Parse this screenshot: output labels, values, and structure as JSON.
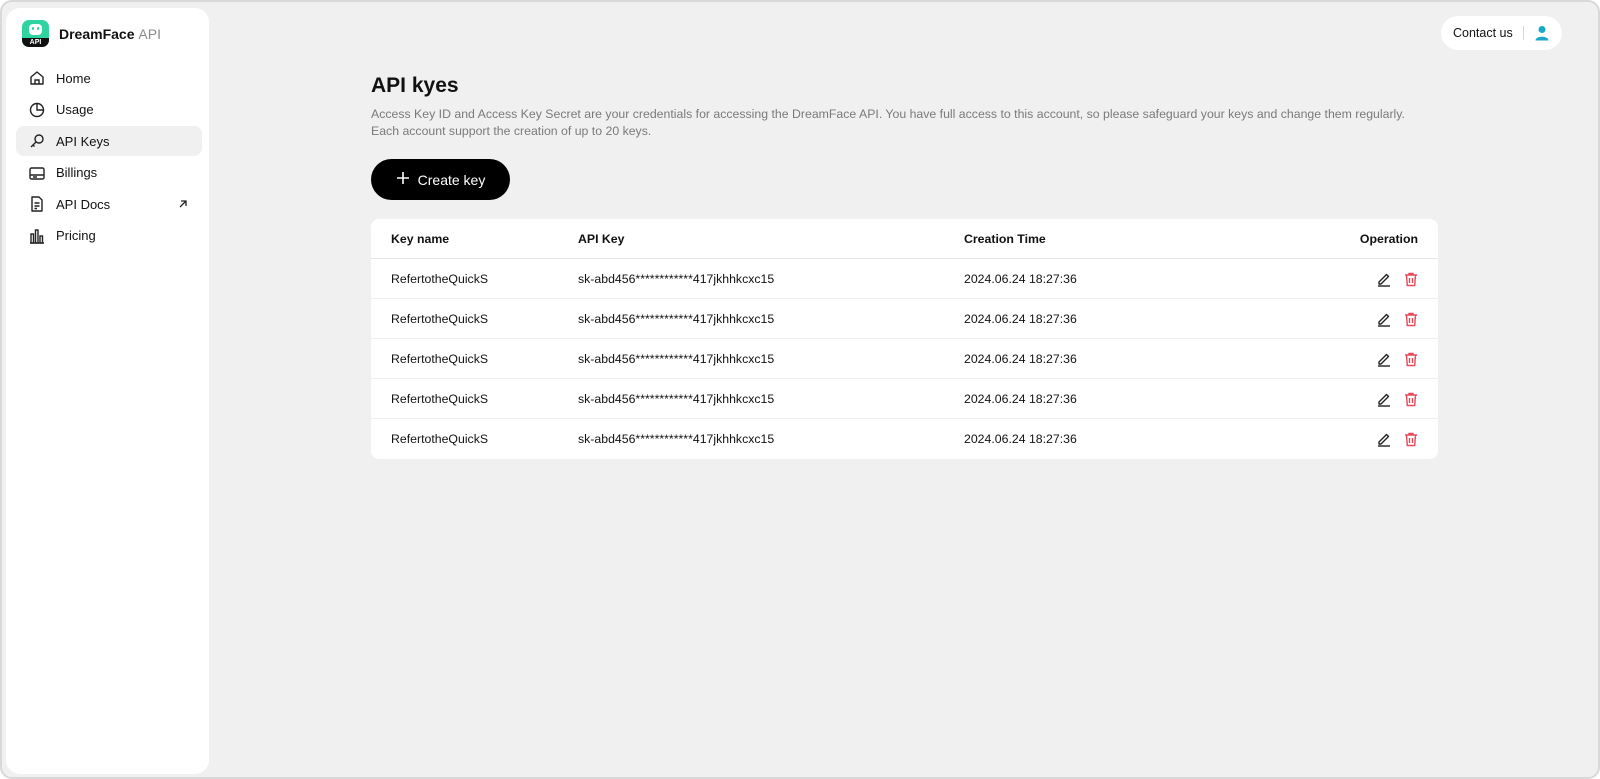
{
  "brand": {
    "name": "DreamFace",
    "suffix": "API",
    "logo_tag": "API"
  },
  "sidebar": {
    "items": [
      {
        "label": "Home",
        "icon": "home-icon"
      },
      {
        "label": "Usage",
        "icon": "pie-chart-icon"
      },
      {
        "label": "API Keys",
        "icon": "key-icon",
        "active": true
      },
      {
        "label": "Billings",
        "icon": "card-icon"
      },
      {
        "label": "API Docs",
        "icon": "document-icon",
        "external": true
      },
      {
        "label": "Pricing",
        "icon": "bar-chart-icon"
      }
    ]
  },
  "header": {
    "contact_label": "Contact us",
    "avatar_icon": "user-icon"
  },
  "page": {
    "title": "API kyes",
    "description": "Access Key ID and Access Key Secret are your credentials for accessing the DreamFace API. You have full access to this account, so please safeguard your keys and change them regularly. Each account support the creation of up to 20 keys.",
    "create_label": "Create key"
  },
  "table": {
    "columns": [
      "Key name",
      "API Key",
      "Creation Time",
      "Operation"
    ],
    "rows": [
      {
        "name": "RefertotheQuickS",
        "key": "sk-abd456************417jkhhkcxc15",
        "time": "2024.06.24 18:27:36"
      },
      {
        "name": "RefertotheQuickS",
        "key": "sk-abd456************417jkhhkcxc15",
        "time": "2024.06.24 18:27:36"
      },
      {
        "name": "RefertotheQuickS",
        "key": "sk-abd456************417jkhhkcxc15",
        "time": "2024.06.24 18:27:36"
      },
      {
        "name": "RefertotheQuickS",
        "key": "sk-abd456************417jkhhkcxc15",
        "time": "2024.06.24 18:27:36"
      },
      {
        "name": "RefertotheQuickS",
        "key": "sk-abd456************417jkhhkcxc15",
        "time": "2024.06.24 18:27:36"
      }
    ]
  },
  "colors": {
    "brand": "#2ed3a0",
    "delete": "#e8485c",
    "avatar": "#1aa7c8",
    "background": "#f0f0f0"
  }
}
